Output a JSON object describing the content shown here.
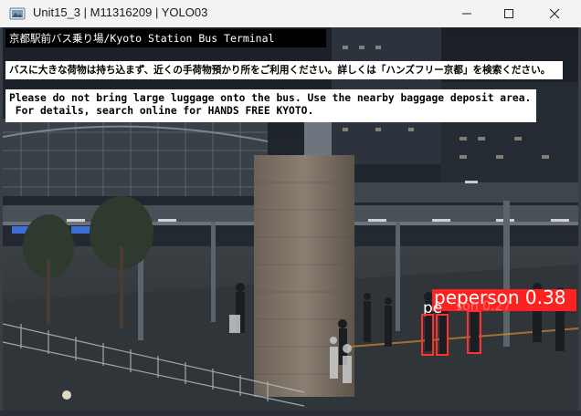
{
  "window": {
    "title": "Unit15_3 | M11316209 | YOLO03",
    "minimize_glyph": "—",
    "maximize_glyph": "☐",
    "close_glyph": "✕",
    "icon": "opencv-window-icon"
  },
  "overlay": {
    "location_title": "京都駅前バス乗り場/Kyoto Station Bus Terminal",
    "notice_jp": "バスに大きな荷物は持ち込まず、近くの手荷物預かり所をご利用ください。詳しくは「ハンズフリー京都」を検索ください。",
    "notice_en_line1": "Please do not bring large luggage onto the bus. Use the nearby baggage deposit area.",
    "notice_en_line2": " For details, search online for HANDS FREE KYOTO."
  },
  "detections": [
    {
      "label": "peperson 0.38",
      "class": "person",
      "score": 0.38
    },
    {
      "label": "pe",
      "class": "person",
      "score": null
    },
    {
      "label": "son 0.27",
      "class": "person",
      "score": 0.27
    }
  ],
  "colors": {
    "detection_box": "#ff3030",
    "titlebar": "#f3f3f3",
    "osd_black": "#000000",
    "osd_white": "#ffffff"
  }
}
